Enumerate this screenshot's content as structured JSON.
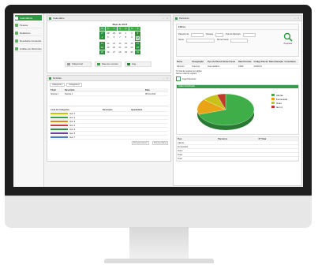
{
  "sidebar": {
    "items": [
      {
        "label": "Calendários",
        "active": true
      },
      {
        "label": "Pessoa",
        "active": false
      },
      {
        "label": "Relatórios",
        "active": false
      },
      {
        "label": "Resultado Conteúdo",
        "active": false
      },
      {
        "label": "Análise de Diretórios",
        "active": false
      }
    ]
  },
  "calendar_panel": {
    "title": "Calendário",
    "month_label": "Maio de 2014",
    "prev": "‹",
    "next": "›",
    "weekday_headers": [
      "D",
      "S",
      "T",
      "Q",
      "Q",
      "S",
      "S"
    ],
    "days": [
      "27",
      "28",
      "29",
      "30",
      "1",
      "2",
      "3",
      "4",
      "5",
      "6",
      "7",
      "8",
      "9",
      "10",
      "11",
      "12",
      "13",
      "14",
      "15",
      "16",
      "17",
      "18",
      "19",
      "20",
      "21",
      "22",
      "23",
      "24",
      "25",
      "26",
      "27",
      "28",
      "29",
      "30",
      "31"
    ],
    "selected_day": "10",
    "legend": [
      {
        "label": "Indisponível",
        "color": "#9e9e9e"
      },
      {
        "label": "Dias sem eventos",
        "color": "#3aa04a"
      },
      {
        "label": "Hoje",
        "color": "#2c7f38"
      }
    ]
  },
  "notes_panel": {
    "title": "Notícias",
    "tabs": [
      "Categoria 1",
      "Categoria 2"
    ],
    "columns": [
      "Título",
      "Descrição",
      "Data"
    ],
    "rows": [
      {
        "title": "Notícia 1",
        "desc": "Notícia 1",
        "date": "08-10-2014"
      }
    ],
    "chart_label": "Lista de Categorias",
    "chart_col_a": "Descrição",
    "chart_col_b": "Quantidade",
    "items": [
      "Item 1",
      "Item 2",
      "Item 3",
      "Item 4",
      "Item 5",
      "Item 6",
      "Item 7"
    ],
    "item_colors": [
      "#c8c400",
      "#3aa04a",
      "#e08a1e",
      "#c84040",
      "#2f8f3c",
      "#6a3ea0",
      "#4a7ac8"
    ],
    "pager_prev": "Primeira Anterior",
    "pager_next": "Próxima Última"
  },
  "partners_panel": {
    "title": "Parceiros",
    "filter_title": "Filtros",
    "filter_fields": [
      "Parceiro de",
      "Pessoa",
      "Tipo de Parceiro",
      "Nome",
      "Nome Fiscal"
    ],
    "search_label": "Pesquisar",
    "columns": [
      "Nome",
      "Designação",
      "Tipo de Parceiro",
      "Nome Fiscal",
      "Data Prevista",
      "Código Parceiro",
      "Data Alteração",
      "Comentário"
    ],
    "rows": [
      {
        "a": "Parceiro",
        "b": "Parceiro",
        "c": "Intermediário",
        "d": "",
        "e": "24/06",
        "f": "24/06/14",
        "g": "",
        "h": ""
      }
    ],
    "footer_lines": [
      "Nº Total de registos por página",
      "Número total de registos"
    ],
    "add_label": "Ligar Parceiros",
    "chart_title": "Gráfico Distribuição",
    "table_cols": [
      "Tipo",
      "Parceiros",
      "Nº Total"
    ],
    "table_rows": [
      "Cliente",
      "Fornecedor",
      "Outro",
      "Total",
      "Total"
    ]
  },
  "chart_data": {
    "type": "pie",
    "title": "",
    "slices": [
      {
        "label": "Cliente",
        "value": 70,
        "color": "#3fae49"
      },
      {
        "label": "Fornecedor",
        "value": 16,
        "color": "#e8a317"
      },
      {
        "label": "Outro",
        "value": 9,
        "color": "#c9c219"
      },
      {
        "label": "Item 4",
        "value": 5,
        "color": "#c0392b"
      }
    ],
    "legend": [
      "Cliente",
      "Fornecedor",
      "Outro",
      "Item 4"
    ],
    "legend_position": "right"
  }
}
